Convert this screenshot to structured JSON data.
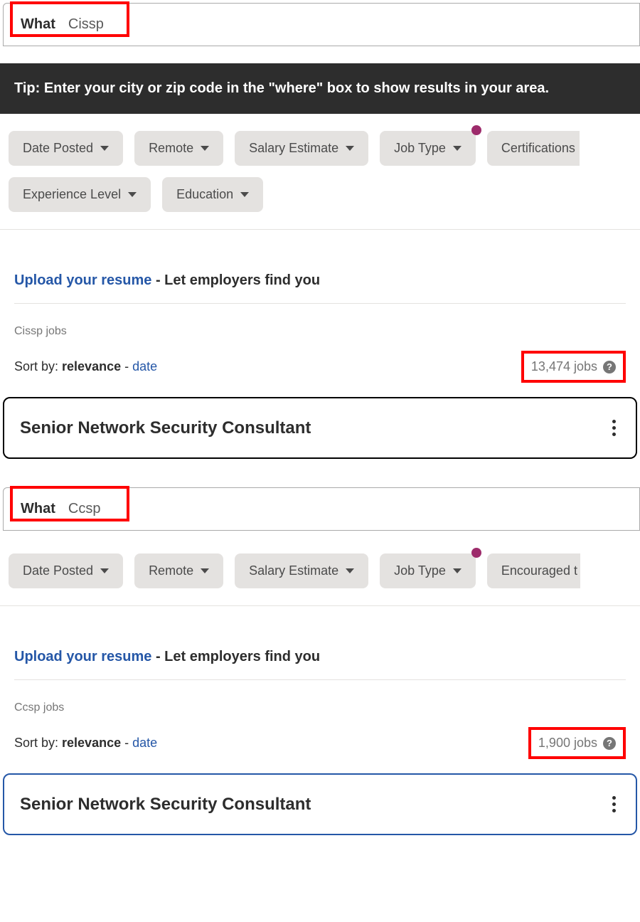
{
  "section1": {
    "search": {
      "label": "What",
      "value": "Cissp"
    },
    "tip": "Tip: Enter your city or zip code in the \"where\" box to show results in your area.",
    "filters": [
      {
        "label": "Date Posted",
        "badge": false
      },
      {
        "label": "Remote",
        "badge": false
      },
      {
        "label": "Salary Estimate",
        "badge": false
      },
      {
        "label": "Job Type",
        "badge": true
      },
      {
        "label": "Certifications",
        "badge": false
      },
      {
        "label": "Experience Level",
        "badge": false
      },
      {
        "label": "Education",
        "badge": false
      }
    ],
    "upload": {
      "link": "Upload your resume",
      "text": " - Let employers find you"
    },
    "queryLabel": "Cissp jobs",
    "sort": {
      "prefix": "Sort by: ",
      "active": "relevance",
      "sep": " - ",
      "other": "date"
    },
    "jobsCount": "13,474 jobs",
    "jobCard": {
      "title": "Senior Network Security Consultant"
    }
  },
  "section2": {
    "search": {
      "label": "What",
      "value": "Ccsp"
    },
    "filters": [
      {
        "label": "Date Posted",
        "badge": false
      },
      {
        "label": "Remote",
        "badge": false
      },
      {
        "label": "Salary Estimate",
        "badge": false
      },
      {
        "label": "Job Type",
        "badge": true
      },
      {
        "label": "Encouraged t",
        "badge": false
      }
    ],
    "upload": {
      "link": "Upload your resume",
      "text": " - Let employers find you"
    },
    "queryLabel": "Ccsp jobs",
    "sort": {
      "prefix": "Sort by: ",
      "active": "relevance",
      "sep": " - ",
      "other": "date"
    },
    "jobsCount": "1,900 jobs",
    "jobCard": {
      "title": "Senior Network Security Consultant"
    }
  }
}
